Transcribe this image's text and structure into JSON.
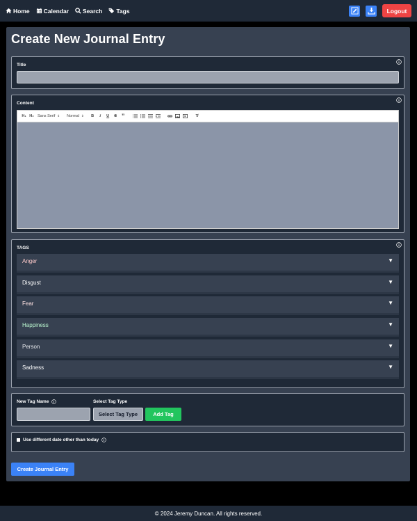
{
  "nav": {
    "links": [
      {
        "label": "Home",
        "icon": "home-icon"
      },
      {
        "label": "Calendar",
        "icon": "calendar-icon"
      },
      {
        "label": "Search",
        "icon": "search-icon"
      },
      {
        "label": "Tags",
        "icon": "tags-icon"
      }
    ],
    "logout_label": "Logout"
  },
  "page": {
    "title": "Create New Journal Entry"
  },
  "title_section": {
    "label": "Title",
    "value": "",
    "placeholder": ""
  },
  "content_section": {
    "label": "Content",
    "toolbar": {
      "h1": "H₁",
      "h2": "H₂",
      "font": "Sans Serif",
      "size": "Normal",
      "bold": "B",
      "italic": "I",
      "underline": "U",
      "strike": "S",
      "quote": "”",
      "clean": "T̸"
    }
  },
  "tags_section": {
    "label": "TAGS",
    "tags": [
      {
        "name": "Anger",
        "color": "#fecaca"
      },
      {
        "name": "Disgust",
        "color": "#ffffff"
      },
      {
        "name": "Fear",
        "color": "#fee2e2"
      },
      {
        "name": "Happiness",
        "color": "#bbf7d0"
      },
      {
        "name": "Person",
        "color": "#e5e7eb"
      },
      {
        "name": "Sadness",
        "color": "#ffffff"
      }
    ]
  },
  "new_tag": {
    "name_label": "New Tag Name",
    "type_label": "Select Tag Type",
    "select_button": "Select Tag Type",
    "add_button": "Add Tag",
    "name_value": ""
  },
  "date_option": {
    "label": "Use different date other than today"
  },
  "create_button": "Create Journal Entry",
  "footer": {
    "text": "© 2024 Jeremy Duncan. All rights reserved."
  },
  "colors": {
    "accent": "#3b82f6",
    "danger": "#ef4444",
    "success": "#22c55e",
    "panel": "#374151",
    "section": "#1f2937"
  }
}
